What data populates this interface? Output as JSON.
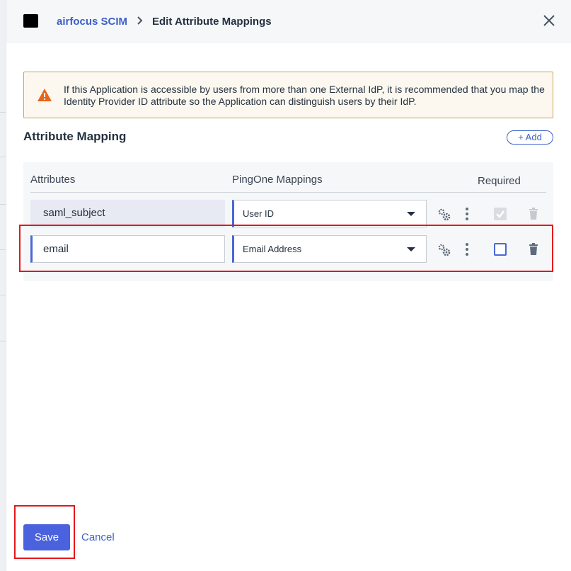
{
  "header": {
    "breadcrumb_link": "airfocus SCIM",
    "breadcrumb_separator": ">",
    "breadcrumb_current": "Edit Attribute Mappings",
    "app_icon": "window-icon",
    "close_icon": "close-icon"
  },
  "alert": {
    "icon": "warning-icon",
    "text": "If this Application is accessible by users from more than one External IdP, it is recommended that you map the Identity Provider ID attribute so the Application can distinguish users by their IdP."
  },
  "mapping": {
    "title": "Attribute Mapping",
    "add_label": "+ Add",
    "columns": [
      "Attributes",
      "PingOne Mappings",
      "Required"
    ],
    "rows": [
      {
        "attribute": "saml_subject",
        "mapping": "User ID",
        "required": true,
        "required_disabled": true,
        "attribute_editable": false
      },
      {
        "attribute": "email",
        "mapping": "Email Address",
        "required": false,
        "required_disabled": false,
        "attribute_editable": true
      }
    ]
  },
  "footer": {
    "save_label": "Save",
    "cancel_label": "Cancel"
  },
  "colors": {
    "accent": "#4a62de",
    "link": "#3c5fc9",
    "warning": "#e4661b",
    "highlight": "#e5171b"
  }
}
